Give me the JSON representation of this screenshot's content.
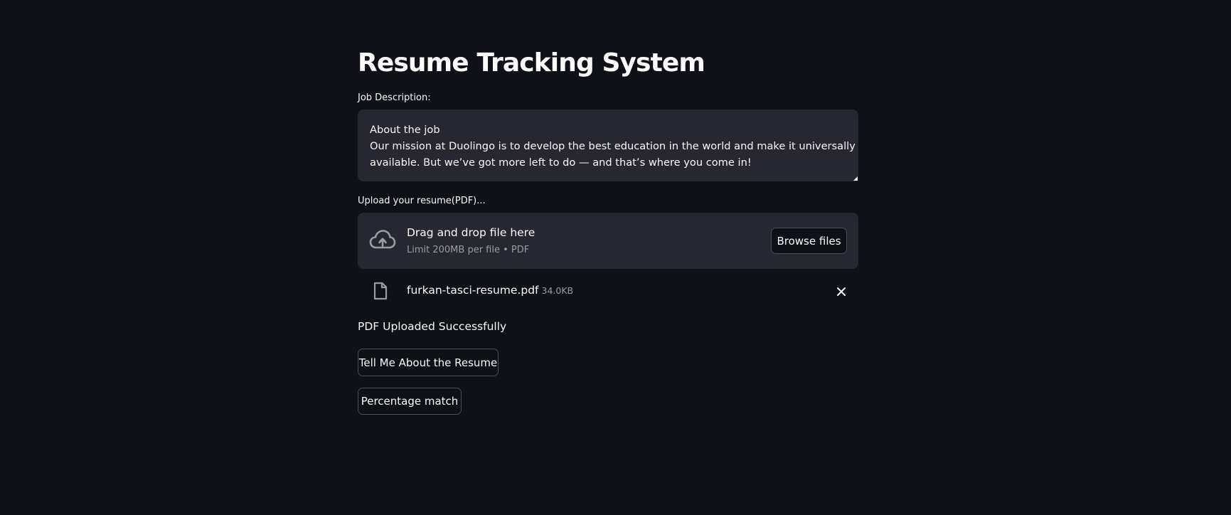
{
  "page": {
    "title": "Resume Tracking System"
  },
  "job_description": {
    "label": "Job Description:",
    "lines": [
      "About the job",
      "Our mission at Duolingo is to develop the best education in the world and make it universally",
      "available. But we’ve got more left to do — and that’s where you come in!"
    ]
  },
  "uploader": {
    "label": "Upload your resume(PDF)...",
    "drop_title": "Drag and drop file here",
    "drop_subtitle": "Limit 200MB per file • PDF",
    "browse_label": "Browse files",
    "icon": "cloud-upload-icon"
  },
  "uploaded_file": {
    "name": "furkan-tasci-resume.pdf",
    "size": "34.0KB",
    "icon": "file-icon",
    "remove_icon": "close-icon"
  },
  "status": {
    "message": "PDF Uploaded Successfully"
  },
  "actions": {
    "tell_me_label": "Tell Me About the Resume",
    "percentage_label": "Percentage match"
  },
  "colors": {
    "background": "#0e1117",
    "panel": "#262730",
    "text": "#fafafa",
    "muted": "#9a9ca3",
    "border": "#4b4d57"
  }
}
